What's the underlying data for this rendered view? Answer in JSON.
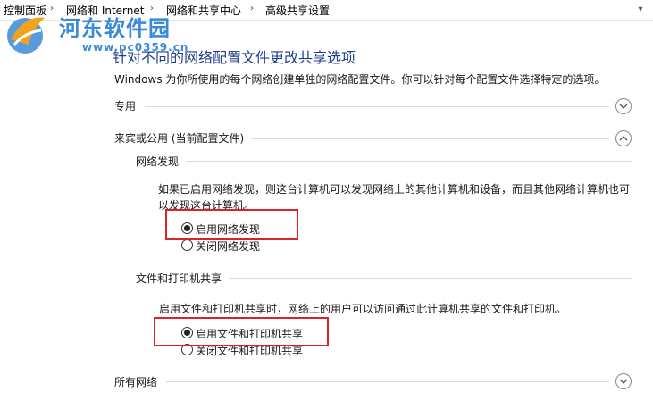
{
  "breadcrumb": {
    "items": [
      "控制面板",
      "网络和 Internet",
      "网络和共享中心",
      "高级共享设置"
    ]
  },
  "watermark": {
    "text": "河东软件园",
    "url": "www.pc0359.cn"
  },
  "page": {
    "title": "针对不同的网络配置文件更改共享选项",
    "description": "Windows 为你所使用的每个网络创建单独的网络配置文件。你可以针对每个配置文件选择特定的选项。"
  },
  "sections": {
    "private": {
      "label": "专用",
      "expanded": false
    },
    "guest": {
      "label": "来宾或公用 (当前配置文件)",
      "expanded": true,
      "network_discovery": {
        "heading": "网络发现",
        "text": "如果已启用网络发现，则这台计算机可以发现网络上的其他计算机和设备，而且其他网络计算机也可以发现这台计算机。",
        "options": [
          "启用网络发现",
          "关闭网络发现"
        ],
        "selected": 0
      },
      "file_printer_sharing": {
        "heading": "文件和打印机共享",
        "text": "启用文件和打印机共享时，网络上的用户可以访问通过此计算机共享的文件和打印机。",
        "options": [
          "启用文件和打印机共享",
          "关闭文件和打印机共享"
        ],
        "selected": 0
      }
    },
    "all_networks": {
      "label": "所有网络",
      "expanded": false
    }
  },
  "colors": {
    "title": "#1e3e8c",
    "highlight": "#d9232a",
    "watermark": "#3a8ad8"
  }
}
